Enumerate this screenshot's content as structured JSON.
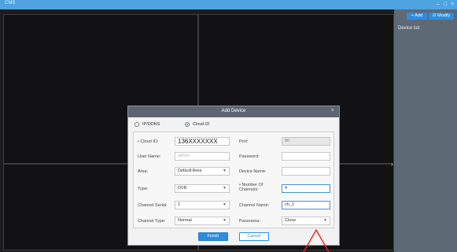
{
  "app": {
    "title": "CMS"
  },
  "right_panel": {
    "add_label": "+ Add",
    "modify_label": "☑ Modify",
    "device_list_label": "Device list"
  },
  "dialog": {
    "title": "Add Device",
    "mode_options": [
      "IP/DDNS",
      "Cloud ID"
    ],
    "selected_mode": "Cloud ID",
    "fields": {
      "cloud_id": {
        "label": "• Cloud ID:",
        "value": "136XXXXXXX"
      },
      "port": {
        "label": "Port:",
        "value": "80"
      },
      "user_name": {
        "label": "User Name:",
        "placeholder": "admin"
      },
      "password": {
        "label": "Password:",
        "value": ""
      },
      "area": {
        "label": "Area:",
        "value": "Default Area"
      },
      "device_name": {
        "label": "Device Name:",
        "value": ""
      },
      "type": {
        "label": "Type:",
        "value": "DVR"
      },
      "number_of_channels": {
        "label": "• Number Of Channels:",
        "value": "4"
      },
      "channel_serial": {
        "label": "Channel Serial:",
        "value": "1"
      },
      "channel_name": {
        "label": "Channel Name:",
        "value": "ch_1"
      },
      "channel_type": {
        "label": "Channel Type:",
        "value": "Normal"
      },
      "panorama": {
        "label": "Panorama:",
        "value": "Close"
      }
    },
    "finish_label": "Finish",
    "cancel_label": "Cancel"
  },
  "colors": {
    "accent": "#2d8ce0",
    "annotation": "#ff1a1a",
    "titlebar": "#4fa3e0"
  }
}
